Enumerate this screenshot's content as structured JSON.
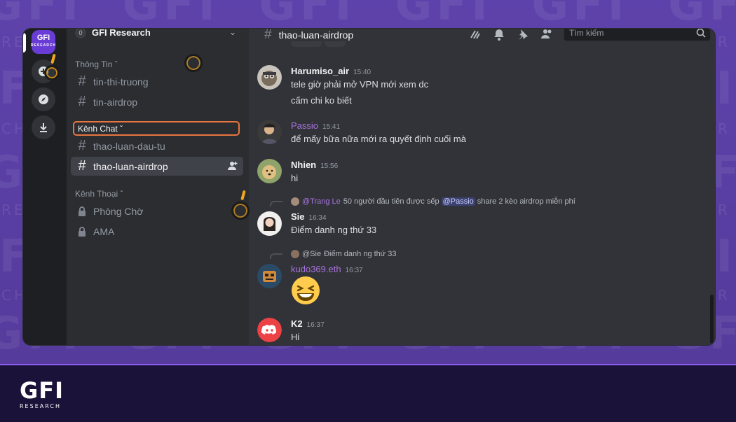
{
  "background": {
    "brand_color": "#5b3fa6",
    "watermark_text": "GFI RESEARCH"
  },
  "brand_footer": {
    "logo_big": "GFI",
    "logo_small": "RESEARCH"
  },
  "server": {
    "name": "GFI Research",
    "badge": "0",
    "rail_logo": "GFI",
    "rail_logo_small": "RESEARCH"
  },
  "sidebar": {
    "categories": [
      {
        "label": "Thông Tin",
        "channels": [
          {
            "name": "tin-thi-truong"
          },
          {
            "name": "tin-airdrop"
          }
        ]
      },
      {
        "label": "Kênh Chat",
        "channels": [
          {
            "name": "thao-luan-dau-tu"
          },
          {
            "name": "thao-luan-airdrop",
            "active": true
          }
        ]
      },
      {
        "label": "Kênh Thoại",
        "channels": [
          {
            "name": "Phòng Chờ"
          },
          {
            "name": "AMA"
          }
        ]
      }
    ]
  },
  "topbar": {
    "channel_name": "thao-luan-airdrop",
    "search_placeholder": "Tìm kiếm"
  },
  "messages": [
    {
      "author": "Harumiso_air",
      "time": "15:40",
      "lines": [
        "tele giờ phải mở VPN mới xem dc",
        "cấm chi ko biết"
      ]
    },
    {
      "author": "Passio",
      "time": "15:41",
      "lines": [
        "để mấy bữa nữa mới ra quyết định cuối mà"
      ]
    },
    {
      "author": "Nhien",
      "time": "15:56",
      "lines": [
        "hi"
      ]
    },
    {
      "author": "Sie",
      "time": "16:34",
      "lines": [
        "Điểm danh ng thứ 33"
      ],
      "reply": {
        "author": "@Trang Le",
        "text_before": "50 người đầu tiên được sếp",
        "mention": "@Passio",
        "text_after": "share 2 kèo airdrop miễn phí"
      }
    },
    {
      "author": "kudo369.eth",
      "time": "16:37",
      "emoji": "😆",
      "reply": {
        "author": "@Sie",
        "text": "Điểm danh ng thứ 33"
      }
    },
    {
      "author": "K2",
      "time": "16:37",
      "lines": [
        "Hi"
      ]
    }
  ]
}
